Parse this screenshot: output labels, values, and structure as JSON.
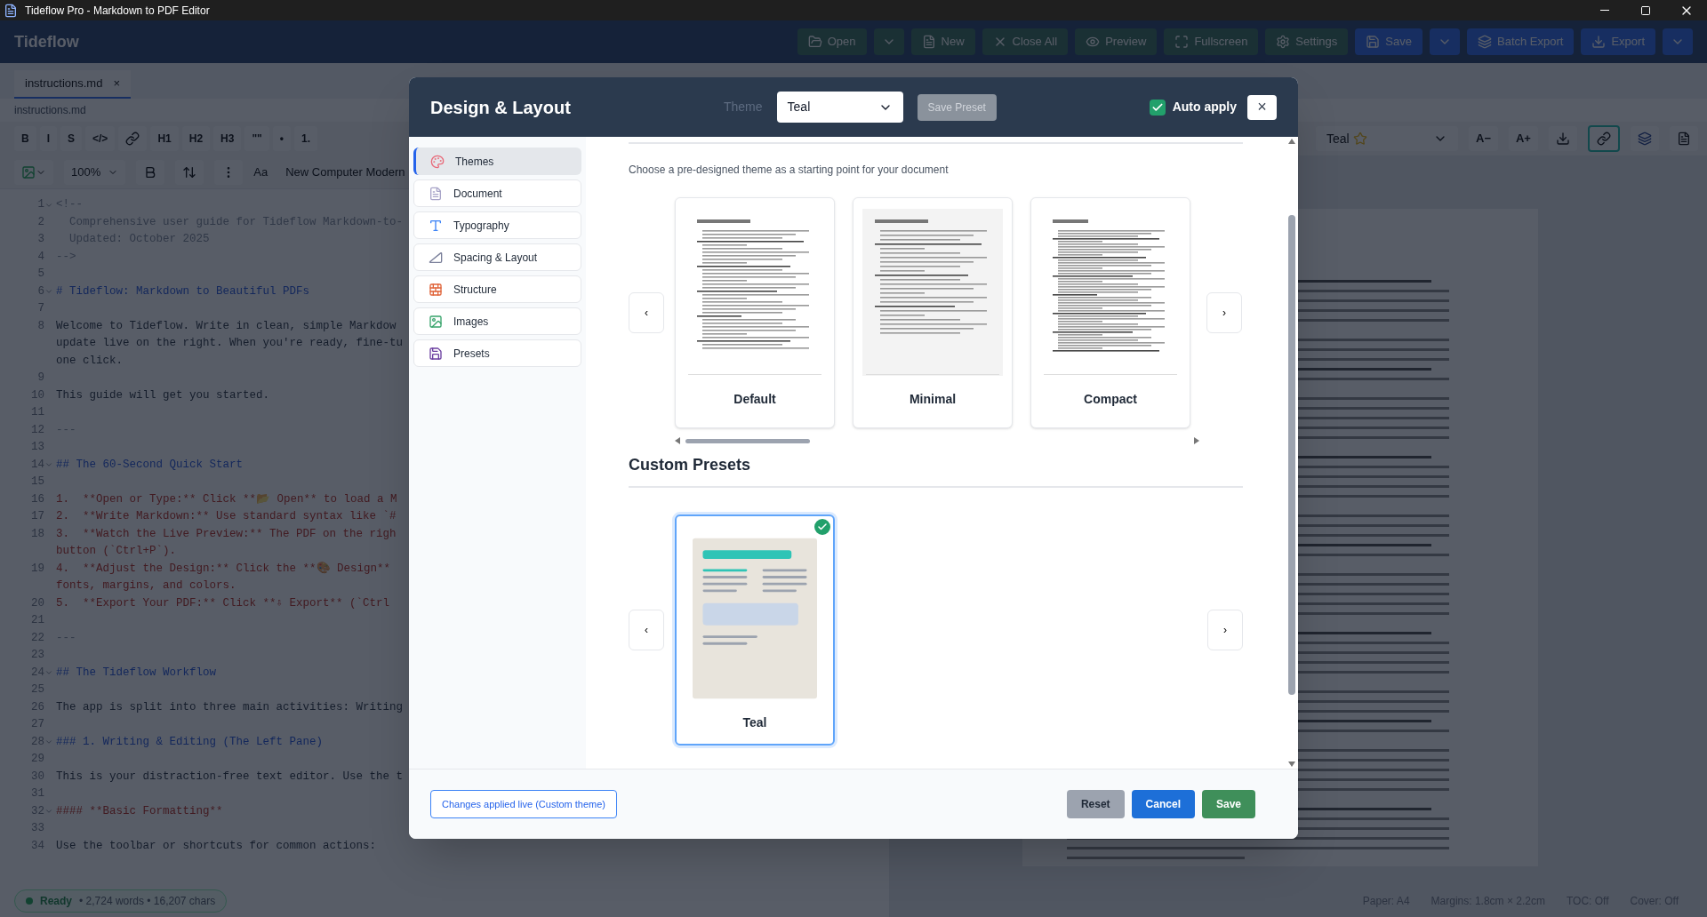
{
  "window": {
    "title": "Tideflow Pro - Markdown to PDF Editor"
  },
  "app_header": {
    "logo": "Tideflow",
    "buttons": [
      {
        "kind": "button",
        "label": "Open"
      },
      {
        "kind": "caret"
      },
      {
        "kind": "button",
        "label": "New"
      },
      {
        "kind": "button",
        "label": "Close All"
      },
      {
        "kind": "button",
        "label": "Preview"
      },
      {
        "kind": "button",
        "label": "Fullscreen"
      },
      {
        "kind": "button",
        "label": "Settings"
      },
      {
        "kind": "button",
        "label": "Save"
      },
      {
        "kind": "caret"
      },
      {
        "kind": "button",
        "label": "Batch Export"
      },
      {
        "kind": "button",
        "label": "Export"
      },
      {
        "kind": "caret"
      }
    ]
  },
  "tabs": [
    {
      "label": "instructions.md",
      "close": "×",
      "selected": true
    }
  ],
  "file_path": "instructions.md",
  "editor_toolbar": {
    "row_1": [
      "B",
      "I",
      "S",
      "</>",
      "H1",
      "H2",
      "H3",
      "\"\"",
      "•",
      "1."
    ],
    "zoom": "100%",
    "font_label": "Aa",
    "font": "New Computer Modern"
  },
  "editor": {
    "lines": [
      {
        "number": "1",
        "kind": "comment",
        "foldable": true,
        "rows": [
          "<!--"
        ]
      },
      {
        "number": "2",
        "kind": "comment",
        "foldable": false,
        "rows": [
          "  Comprehensive user guide for Tideflow Markdown-to-"
        ]
      },
      {
        "number": "3",
        "kind": "comment",
        "foldable": false,
        "rows": [
          "  Updated: October 2025"
        ]
      },
      {
        "number": "4",
        "kind": "comment",
        "foldable": false,
        "rows": [
          "-->"
        ]
      },
      {
        "number": "5",
        "foldable": false
      },
      {
        "number": "6",
        "kind": "heading",
        "foldable": true,
        "rows": [
          "# Tideflow: Markdown to Beautiful PDFs"
        ]
      },
      {
        "number": "7",
        "foldable": false
      },
      {
        "number": "8",
        "kind": "text",
        "foldable": false,
        "rows": [
          "Welcome to Tideflow. Write in clean, simple Markdow",
          "update live on the right. When you're ready, fine-tu",
          "one click."
        ]
      },
      {
        "number": "9",
        "foldable": false
      },
      {
        "number": "10",
        "kind": "text",
        "foldable": false,
        "rows": [
          "This guide will get you started."
        ]
      },
      {
        "number": "11",
        "foldable": false
      },
      {
        "number": "12",
        "kind": "comment",
        "foldable": false,
        "rows": [
          "---"
        ]
      },
      {
        "number": "13",
        "foldable": false
      },
      {
        "number": "14",
        "kind": "heading",
        "foldable": true,
        "rows": [
          "## The 60-Second Quick Start"
        ]
      },
      {
        "number": "15",
        "foldable": false
      },
      {
        "number": "16",
        "kind": "list",
        "foldable": false,
        "rows": [
          "1.  **Open or Type:** Click **📂 Open** to load a M"
        ]
      },
      {
        "number": "17",
        "kind": "list",
        "foldable": false,
        "rows": [
          "2.  **Write Markdown:** Use standard syntax like `#"
        ]
      },
      {
        "number": "18",
        "kind": "list",
        "foldable": false,
        "rows": [
          "3.  **Watch the Live Preview:** The PDF on the righ",
          "button (`Ctrl+P`)."
        ]
      },
      {
        "number": "19",
        "kind": "list",
        "foldable": false,
        "rows": [
          "4.  **Adjust the Design:** Click the **🎨 Design** ",
          "fonts, margins, and colors."
        ]
      },
      {
        "number": "20",
        "kind": "list",
        "foldable": false,
        "rows": [
          "5.  **Export Your PDF:** Click **⇩ Export** (`Ctrl"
        ]
      },
      {
        "number": "21",
        "foldable": false
      },
      {
        "number": "22",
        "kind": "comment",
        "foldable": false,
        "rows": [
          "---"
        ]
      },
      {
        "number": "23",
        "foldable": false
      },
      {
        "number": "24",
        "kind": "heading",
        "foldable": true,
        "rows": [
          "## The Tideflow Workflow"
        ]
      },
      {
        "number": "25",
        "foldable": false
      },
      {
        "number": "26",
        "kind": "text",
        "foldable": false,
        "rows": [
          "The app is split into three main activities: Writing"
        ]
      },
      {
        "number": "27",
        "foldable": false
      },
      {
        "number": "28",
        "kind": "heading",
        "foldable": true,
        "rows": [
          "### 1. Writing & Editing (The Left Pane)"
        ]
      },
      {
        "number": "29",
        "foldable": false
      },
      {
        "number": "30",
        "kind": "text",
        "foldable": false,
        "rows": [
          "This is your distraction-free text editor. Use the t"
        ]
      },
      {
        "number": "31",
        "foldable": false
      },
      {
        "number": "32",
        "kind": "list",
        "foldable": true,
        "rows": [
          "#### **Basic Formatting**"
        ]
      },
      {
        "number": "33",
        "foldable": false
      },
      {
        "number": "34",
        "kind": "text",
        "foldable": false,
        "rows": [
          "Use the toolbar or shortcuts for common actions:"
        ]
      }
    ]
  },
  "status_bar": {
    "state": "Ready",
    "counts": "• 2,724 words • 16,207 chars"
  },
  "preview_toolbar": {
    "theme": "Teal",
    "buttons": [
      "A−",
      "A+"
    ]
  },
  "preview_footer": [
    "Paper: A4",
    "Margins: 1.8cm × 2.2cm",
    "TOC: Off",
    "Cover: Off"
  ],
  "dialog": {
    "title": "Design & Layout",
    "theme_label": "Theme",
    "theme_value": "Teal",
    "save_preset": {
      "label": "Save Preset",
      "disabled": true
    },
    "auto_apply": {
      "label": "Auto apply",
      "checked": true
    },
    "close": "×",
    "sidebar": [
      {
        "label": "Themes",
        "selected": true
      },
      {
        "label": "Document",
        "selected": false
      },
      {
        "label": "Typography",
        "selected": false
      },
      {
        "label": "Spacing & Layout",
        "selected": false
      },
      {
        "label": "Structure",
        "selected": false
      },
      {
        "label": "Images",
        "selected": false
      },
      {
        "label": "Presets",
        "selected": false
      }
    ],
    "intro": "Choose a pre-designed theme as a starting point for your document",
    "prev": "‹",
    "next": "›",
    "themes": [
      {
        "name": "Default",
        "selected": false
      },
      {
        "name": "Minimal",
        "selected": false
      },
      {
        "name": "Compact",
        "selected": false
      }
    ],
    "custom_presets_title": "Custom Presets",
    "presets": [
      {
        "name": "Teal",
        "selected": true
      }
    ],
    "live_note": "Changes applied live (Custom theme)",
    "buttons": [
      {
        "label": "Reset",
        "kind": "neutral"
      },
      {
        "label": "Cancel",
        "kind": "primary"
      },
      {
        "label": "Save",
        "kind": "success"
      }
    ]
  }
}
